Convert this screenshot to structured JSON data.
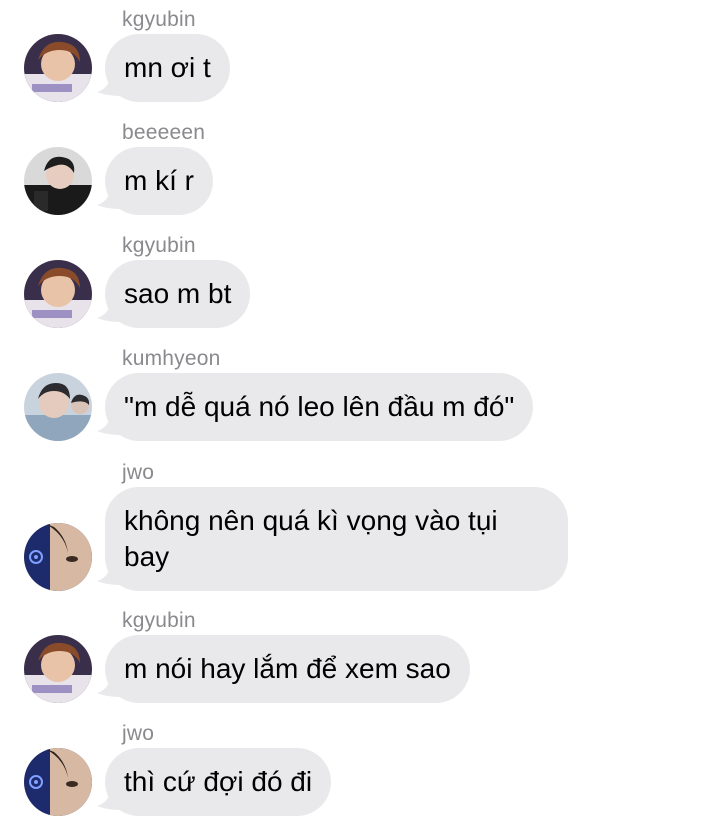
{
  "messages": [
    {
      "sender": "kgyubin",
      "text": "mn ơi t",
      "avatar": "avatar-kgyubin"
    },
    {
      "sender": "beeeeen",
      "text": "m kí r",
      "avatar": "avatar-beeeeen"
    },
    {
      "sender": "kgyubin",
      "text": "sao m bt",
      "avatar": "avatar-kgyubin"
    },
    {
      "sender": "kumhyeon",
      "text": "\"m dễ quá nó leo lên đầu m đó\"",
      "avatar": "avatar-kumhyeon"
    },
    {
      "sender": "jwo",
      "text": "không nên quá kì vọng vào tụi bay",
      "avatar": "avatar-jwo"
    },
    {
      "sender": "kgyubin",
      "text": "m nói hay lắm để xem sao",
      "avatar": "avatar-kgyubin"
    },
    {
      "sender": "jwo",
      "text": "thì cứ đợi đó đi",
      "avatar": "avatar-jwo"
    }
  ],
  "colors": {
    "bubble": "#e9e9eb",
    "sender": "#8a8a8e",
    "text": "#000000",
    "background": "#ffffff"
  }
}
